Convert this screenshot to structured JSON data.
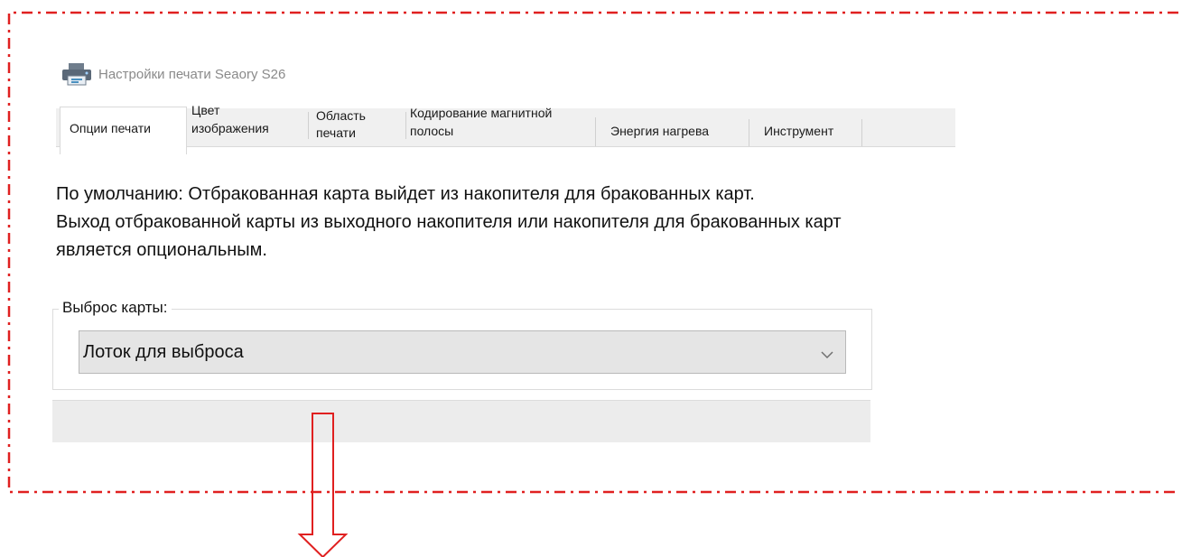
{
  "window": {
    "title": "Настройки печати Seaory S26",
    "icon": "printer-icon"
  },
  "tabs": [
    {
      "label": "Опции печати",
      "active": true
    },
    {
      "label_line1": "Цвет",
      "label_line2": "изображения"
    },
    {
      "label_line1": "Область",
      "label_line2": "печати"
    },
    {
      "label_line1": "Кодирование магнитной",
      "label_line2": "полосы"
    },
    {
      "label": "Энергия нагрева"
    },
    {
      "label": "Инструмент"
    }
  ],
  "description": {
    "line1": "По умолчанию: Отбракованная карта выйдет из накопителя для бракованных карт.",
    "line2": "Выход отбракованной карты из выходного накопителя или накопителя для бракованных карт",
    "line3": "является опциональным."
  },
  "card_eject": {
    "legend": "Выброс карты:",
    "selected_value": "Лоток для выброса",
    "dropdown_icon": "chevron-down-icon"
  },
  "annotation": {
    "frame_color": "#e02020",
    "arrow_color": "#e02020",
    "arrow_icon": "down-arrow-icon"
  }
}
